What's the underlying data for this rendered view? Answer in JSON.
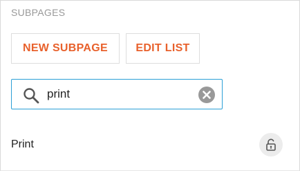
{
  "section": {
    "title": "SUBPAGES"
  },
  "buttons": {
    "new_subpage": "NEW SUBPAGE",
    "edit_list": "EDIT LIST"
  },
  "search": {
    "value": "print",
    "icon": "search-icon",
    "clear_icon": "clear-icon"
  },
  "results": [
    {
      "label": "Print",
      "action_icon": "lock-open-icon"
    }
  ],
  "colors": {
    "accent": "#e8612c",
    "focus_border": "#2a9fd6",
    "muted_text": "#999999"
  }
}
